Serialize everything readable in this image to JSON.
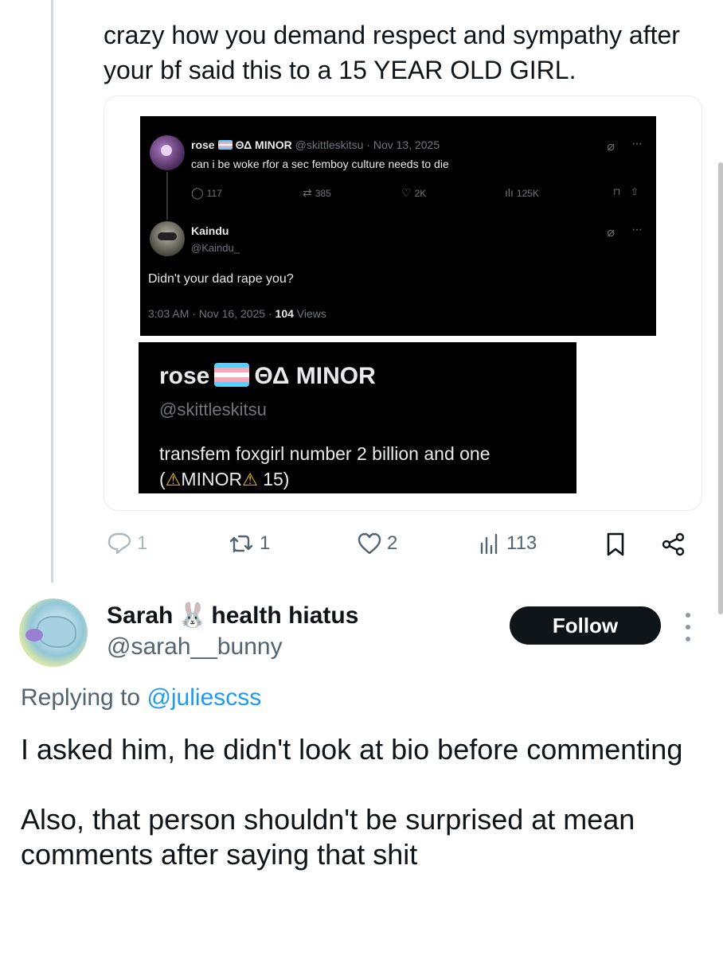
{
  "parent_tweet": {
    "text": "crazy how you demand respect and sympathy after your bf said this to a 15 YEAR OLD GIRL.",
    "embedded_screenshot_1": {
      "tweet": {
        "name": "rose",
        "name_suffix": "ΘΔ MINOR",
        "handle": "@skittleskitsu",
        "date": "· Nov 13, 2025",
        "body": "can i be woke rfor a sec femboy culture needs to die",
        "replies": "117",
        "retweets": "385",
        "likes": "2K",
        "views": "125K"
      },
      "reply": {
        "name": "Kaindu",
        "handle": "@Kaindu_",
        "body": "Didn't your dad rape you?",
        "meta": "3:03 AM · Nov 16, 2025 · ",
        "views_count": "104",
        "views_label": " Views"
      }
    },
    "embedded_screenshot_2": {
      "name": "rose",
      "name_suffix": "ΘΔ MINOR",
      "handle": "@skittleskitsu",
      "bio_line1": "transfem foxgirl number 2 billion and one",
      "bio_line2_open": "(",
      "bio_line2_minor": "MINOR",
      "bio_line2_age": " 15)"
    },
    "actions": {
      "replies": "1",
      "retweets": "1",
      "likes": "2",
      "views": "113"
    }
  },
  "reply_tweet": {
    "display_name": "Sarah",
    "name_emoji": "🐰",
    "display_name_suffix": "health hiatus",
    "handle": "@sarah__bunny",
    "follow_label": "Follow",
    "replying_prefix": "Replying to ",
    "replying_to": "@juliescss",
    "body_paragraph_1": "I asked him, he didn't look at bio before commenting",
    "body_paragraph_2": "Also, that person shouldn't be surprised at mean comments after saying that shit"
  },
  "colors": {
    "text_primary": "#0f1419",
    "text_secondary": "#536471",
    "link": "#1d9bf0",
    "follow_bg": "#0f1419",
    "warning": "#f4c01e"
  },
  "icons": [
    "reply-icon",
    "retweet-icon",
    "like-icon",
    "views-icon",
    "bookmark-icon",
    "share-icon",
    "grok-icon",
    "more-icon",
    "trans-flag-icon",
    "warning-icon"
  ]
}
